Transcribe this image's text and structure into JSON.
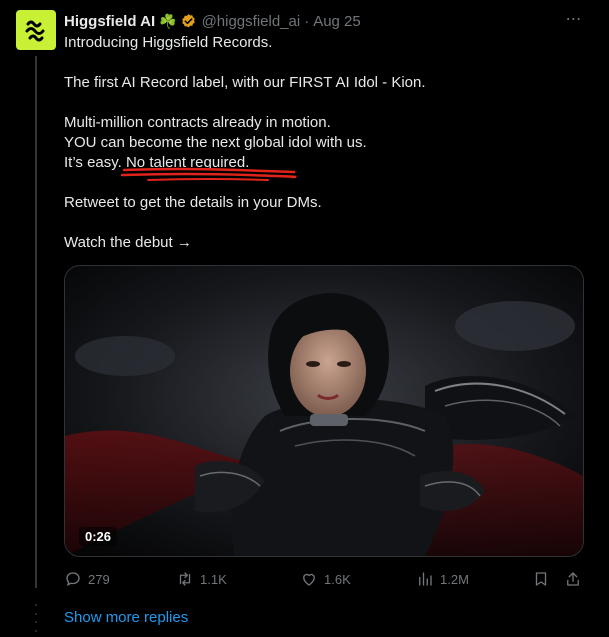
{
  "tweet": {
    "author": {
      "name": "Higgsfield AI",
      "emoji": "☘️",
      "handle": "@higgsfield_ai",
      "separator": "·",
      "date": "Aug 25"
    },
    "more_icon": "⋯",
    "body_lines": [
      "Introducing Higgsfield Records.",
      "The first AI Record label, with our FIRST AI Idol - Kion.",
      "Multi-million contracts already in motion.",
      "YOU can become the next global idol with us.",
      "It’s easy. No talent required.",
      "Retweet to get the details in your DMs.",
      "Watch the debut →"
    ],
    "media": {
      "duration": "0:26"
    },
    "actions": {
      "replies": "279",
      "retweets": "1.1K",
      "likes": "1.6K",
      "views": "1.2M"
    },
    "colors": {
      "avatar_bg": "#c8f135",
      "link": "#1d9bf0",
      "verified": "#e2a11b",
      "scribble": "#e0231b",
      "muted": "#71767b"
    }
  },
  "footer": {
    "show_more": "Show more replies"
  }
}
